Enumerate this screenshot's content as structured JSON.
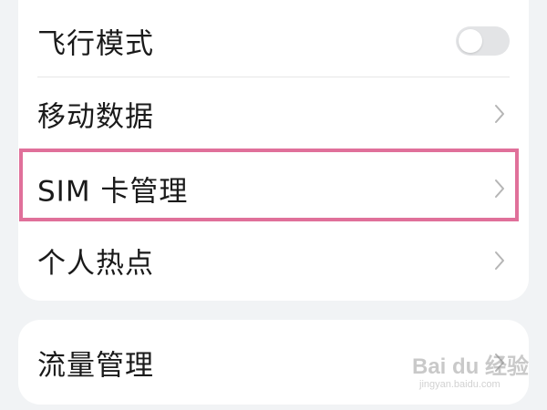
{
  "connection_settings": {
    "items": [
      {
        "label": "飞行模式",
        "control": "toggle",
        "toggle_on": false
      },
      {
        "label": "移动数据",
        "control": "chevron"
      },
      {
        "label": "SIM 卡管理",
        "control": "chevron",
        "highlighted": true
      },
      {
        "label": "个人热点",
        "control": "chevron"
      }
    ]
  },
  "data_settings": {
    "items": [
      {
        "label": "流量管理",
        "control": "chevron"
      }
    ]
  },
  "colors": {
    "highlight_border": "#e0709a",
    "card_background": "#ffffff",
    "page_background": "#f1f3f5",
    "toggle_off": "#e3e4e6"
  },
  "watermark": {
    "main_text": "Bai du 经验",
    "sub_text": "jingyan.baidu.com"
  }
}
